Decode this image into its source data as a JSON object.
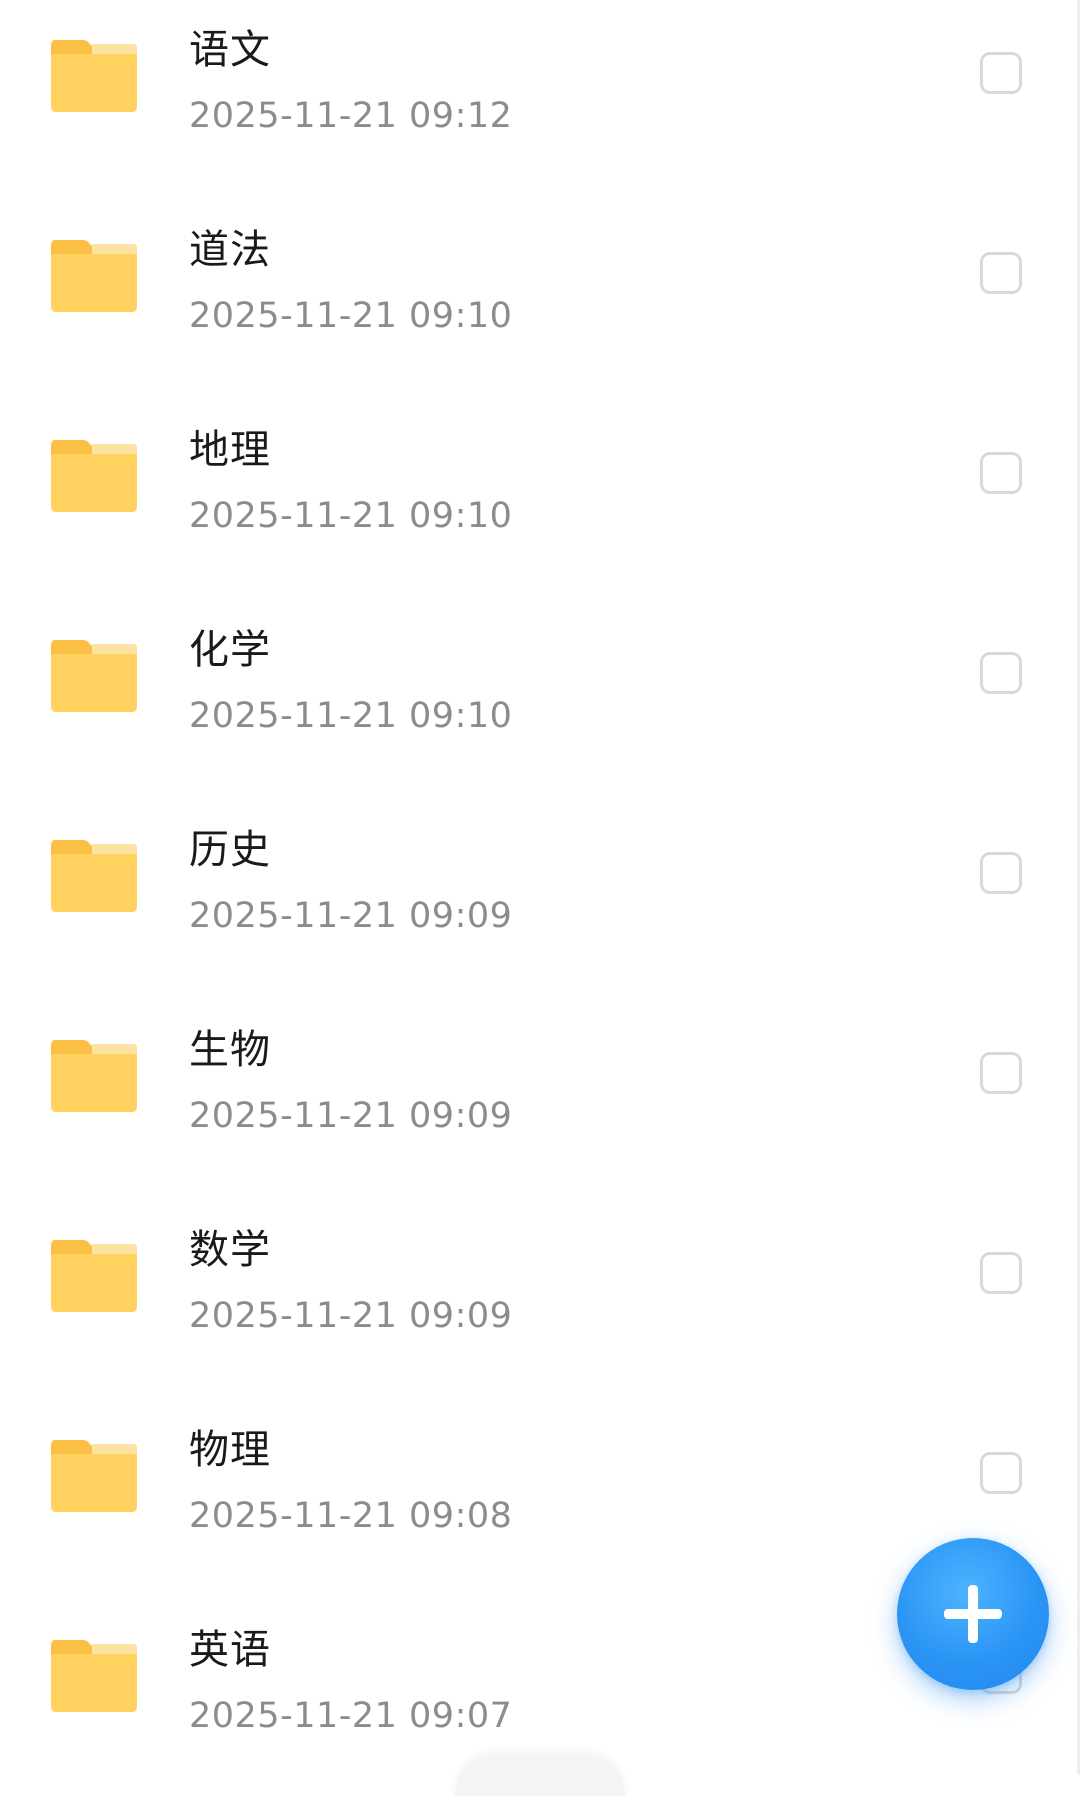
{
  "files": [
    {
      "name": "语文",
      "modified": "2025-11-21 09:12"
    },
    {
      "name": "道法",
      "modified": "2025-11-21 09:10"
    },
    {
      "name": "地理",
      "modified": "2025-11-21 09:10"
    },
    {
      "name": "化学",
      "modified": "2025-11-21 09:10"
    },
    {
      "name": "历史",
      "modified": "2025-11-21 09:09"
    },
    {
      "name": "生物",
      "modified": "2025-11-21 09:09"
    },
    {
      "name": "数学",
      "modified": "2025-11-21 09:09"
    },
    {
      "name": "物理",
      "modified": "2025-11-21 09:08"
    },
    {
      "name": "英语",
      "modified": "2025-11-21 09:07"
    }
  ],
  "icons": {
    "folder": "folder-icon",
    "fab": "plus-icon"
  },
  "colors": {
    "folder": "#FFCF5C",
    "folder_tab": "#FBC04A",
    "fab": "#2B95F5",
    "date_text": "#8C8C8C"
  }
}
